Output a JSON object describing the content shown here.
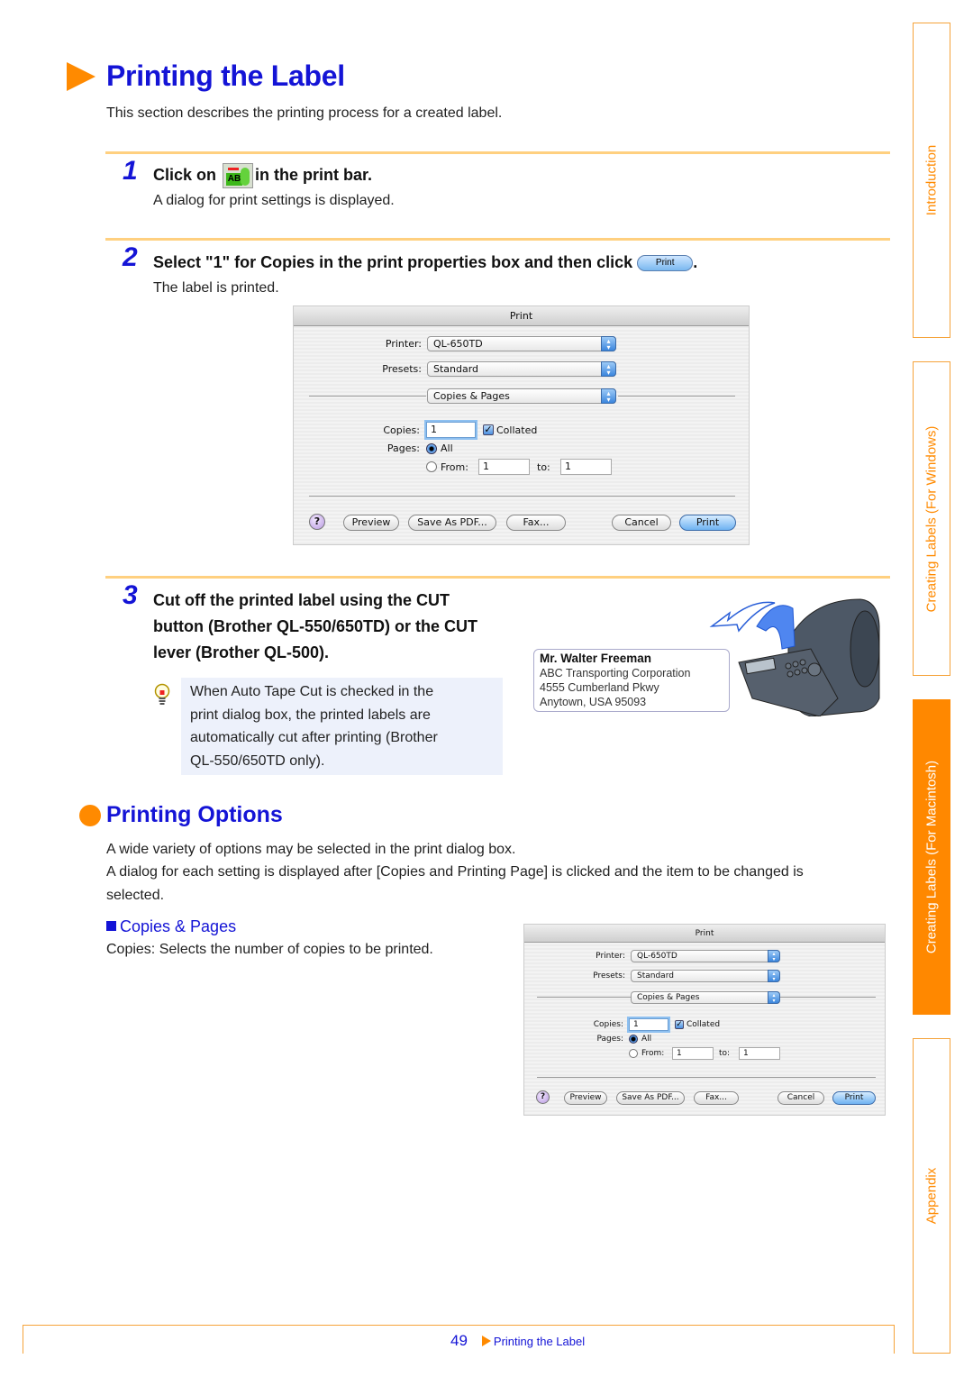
{
  "header": {
    "title": "Printing the Label",
    "intro": "This section describes the printing process for a created label."
  },
  "steps": [
    {
      "number": "1",
      "heading_before": "Click on",
      "icon": "print-bar-ab-icon",
      "heading_after": "in the print bar.",
      "description": "A dialog for print settings is displayed."
    },
    {
      "number": "2",
      "heading_before": "Select \"1\" for Copies in the print properties box and then click",
      "inline_button": "Print",
      "heading_after": ".",
      "description": "The label is printed."
    },
    {
      "number": "3",
      "heading_lines": [
        "Cut off the printed label using the CUT",
        "button (Brother QL-550/650TD) or the CUT",
        "lever (Brother QL-500)."
      ],
      "hint_lines": [
        "When Auto Tape Cut is checked in the",
        "print dialog box, the printed labels are",
        "automatically cut after printing (Brother",
        "QL-550/650TD only)."
      ]
    }
  ],
  "print_dialog": {
    "title": "Print",
    "printer_label": "Printer:",
    "printer_value": "QL-650TD",
    "presets_label": "Presets:",
    "presets_value": "Standard",
    "panel_value": "Copies & Pages",
    "copies_label": "Copies:",
    "copies_value": "1",
    "collated_label": "Collated",
    "collated_checked": true,
    "pages_label": "Pages:",
    "all_label": "All",
    "from_label": "From:",
    "from_value": "1",
    "to_label": "to:",
    "to_value": "1",
    "help_label": "?",
    "buttons": {
      "preview": "Preview",
      "save_pdf": "Save As PDF...",
      "fax": "Fax...",
      "cancel": "Cancel",
      "print": "Print"
    }
  },
  "label_sample": {
    "name": "Mr. Walter Freeman",
    "line1": "ABC Transporting Corporation",
    "line2": "4555 Cumberland Pkwy",
    "line3": "Anytown, USA 95093"
  },
  "options_section": {
    "title": "Printing Options",
    "para1": "A wide variety of options may be selected in the print dialog box.",
    "para2_line1": "A dialog for each setting is displayed after [Copies and Printing Page] is clicked and the item to be changed is",
    "para2_line2": "selected.",
    "subheading": "Copies & Pages",
    "sub_desc": "Copies: Selects the number of copies to be printed."
  },
  "side_tabs": [
    {
      "label": "Introduction",
      "active": false
    },
    {
      "label": "Creating Labels (For Windows)",
      "active": false
    },
    {
      "label": "Creating Labels (For Macintosh)",
      "active": true
    },
    {
      "label": "Appendix",
      "active": false
    }
  ],
  "footer": {
    "page_number": "49",
    "link": "Printing the Label"
  },
  "colors": {
    "accent_orange": "#ff8a00",
    "heading_blue": "#1414d6",
    "rule_yellow": "#ffd080",
    "hint_bg": "#edf1fb"
  }
}
